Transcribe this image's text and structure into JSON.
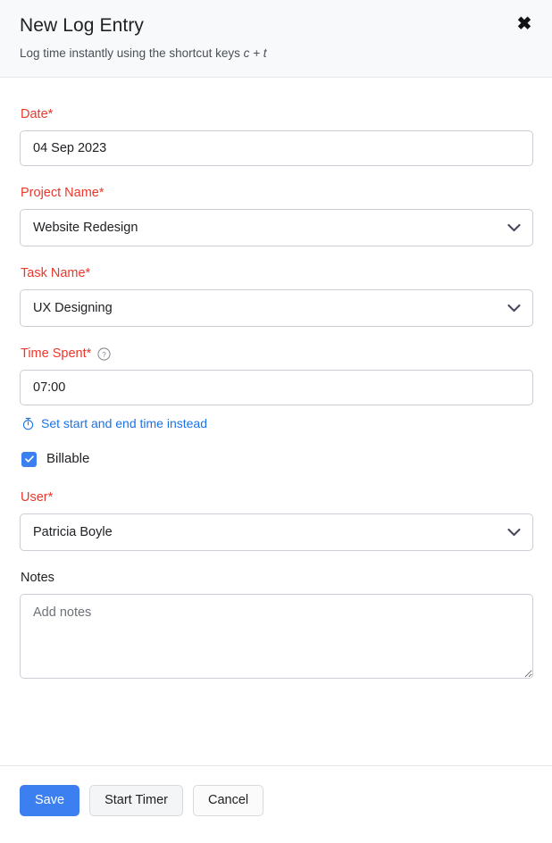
{
  "header": {
    "title": "New Log Entry",
    "subtitle_prefix": "Log time instantly using the shortcut keys ",
    "subtitle_keys": "c + t",
    "close_icon": "close-icon"
  },
  "form": {
    "date": {
      "label": "Date*",
      "value": "04 Sep 2023"
    },
    "project_name": {
      "label": "Project Name*",
      "value": "Website Redesign",
      "chevron_icon": "chevron-down-icon"
    },
    "task_name": {
      "label": "Task Name*",
      "value": "UX Designing",
      "chevron_icon": "chevron-down-icon"
    },
    "time_spent": {
      "label": "Time Spent*",
      "help_icon": "help-circle-icon",
      "value": "07:00",
      "toggle_link": "Set start and end time instead",
      "toggle_icon": "stopwatch-icon"
    },
    "billable": {
      "label": "Billable",
      "checked": true,
      "check_icon": "checkmark-icon"
    },
    "user": {
      "label": "User*",
      "value": "Patricia Boyle",
      "chevron_icon": "chevron-down-icon"
    },
    "notes": {
      "label": "Notes",
      "placeholder": "Add notes",
      "value": ""
    }
  },
  "footer": {
    "save_label": "Save",
    "start_timer_label": "Start Timer",
    "cancel_label": "Cancel"
  },
  "colors": {
    "required_red": "#e8382b",
    "primary_blue": "#3b7ff0",
    "link_blue": "#1a73e8",
    "header_bg": "#f8f9fa",
    "border": "#ccced6"
  }
}
